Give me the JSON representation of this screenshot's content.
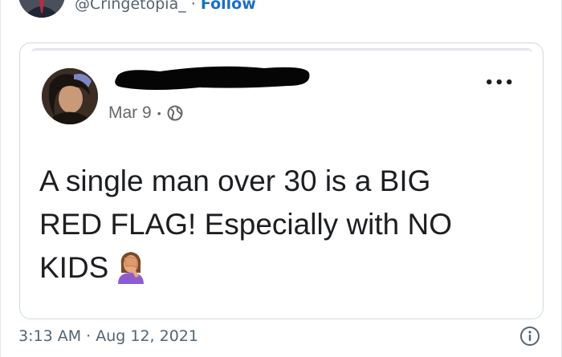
{
  "tweet": {
    "handle": "@Cringetopia_",
    "separator": "·",
    "follow_label": "Follow",
    "timestamp": "3:13 AM · Aug 12, 2021",
    "info_icon": "info-icon"
  },
  "embedded_post": {
    "date": "Mar 9",
    "date_separator": "•",
    "privacy_icon": "globe-icon",
    "more_label": "•••",
    "text_line1": "A single man over 30 is a BIG",
    "text_line2": "RED FLAG! Especially with NO",
    "text_line3": "KIDS",
    "emoji": "woman-facepalming-emoji"
  },
  "colors": {
    "follow": "#1d6fc4",
    "muted": "#536471",
    "border": "#cfd9de"
  }
}
